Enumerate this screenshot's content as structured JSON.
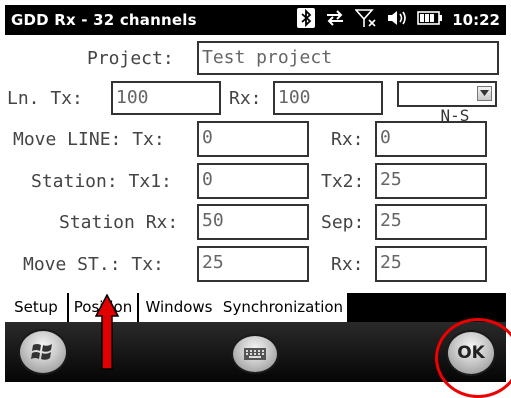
{
  "titlebar": {
    "title": "GDD Rx - 32 channels",
    "time": "10:22",
    "icons": [
      "bluetooth-icon",
      "sync-icon",
      "no-signal-icon",
      "volume-icon",
      "battery-icon"
    ]
  },
  "form": {
    "project": {
      "label": "Project:",
      "value": "Test project"
    },
    "line": {
      "tx_label": "Ln. Tx:",
      "tx_value": "100",
      "rx_label": "Rx:",
      "rx_value": "100",
      "direction": "N-S"
    },
    "move_line": {
      "label": "Move LINE: Tx:",
      "tx_value": "0",
      "rx_label": "Rx:",
      "rx_value": "0"
    },
    "station": {
      "label": "Station: Tx1:",
      "tx1_value": "0",
      "tx2_label": "Tx2:",
      "tx2_value": "25"
    },
    "station_rx": {
      "label": "Station Rx:",
      "value": "50",
      "sep_label": "Sep:",
      "sep_value": "25"
    },
    "move_st": {
      "label": "Move ST.: Tx:",
      "tx_value": "25",
      "rx_label": "Rx:",
      "rx_value": "25"
    }
  },
  "tabs": [
    {
      "label": "Setup"
    },
    {
      "label": "Position"
    },
    {
      "label": "Windows"
    },
    {
      "label": "Synchronization"
    }
  ],
  "menubar": {
    "ok_label": "OK",
    "start_icon": "windows-logo-icon",
    "keyboard_icon": "keyboard-icon"
  },
  "colors": {
    "annotation": "#e00000"
  }
}
